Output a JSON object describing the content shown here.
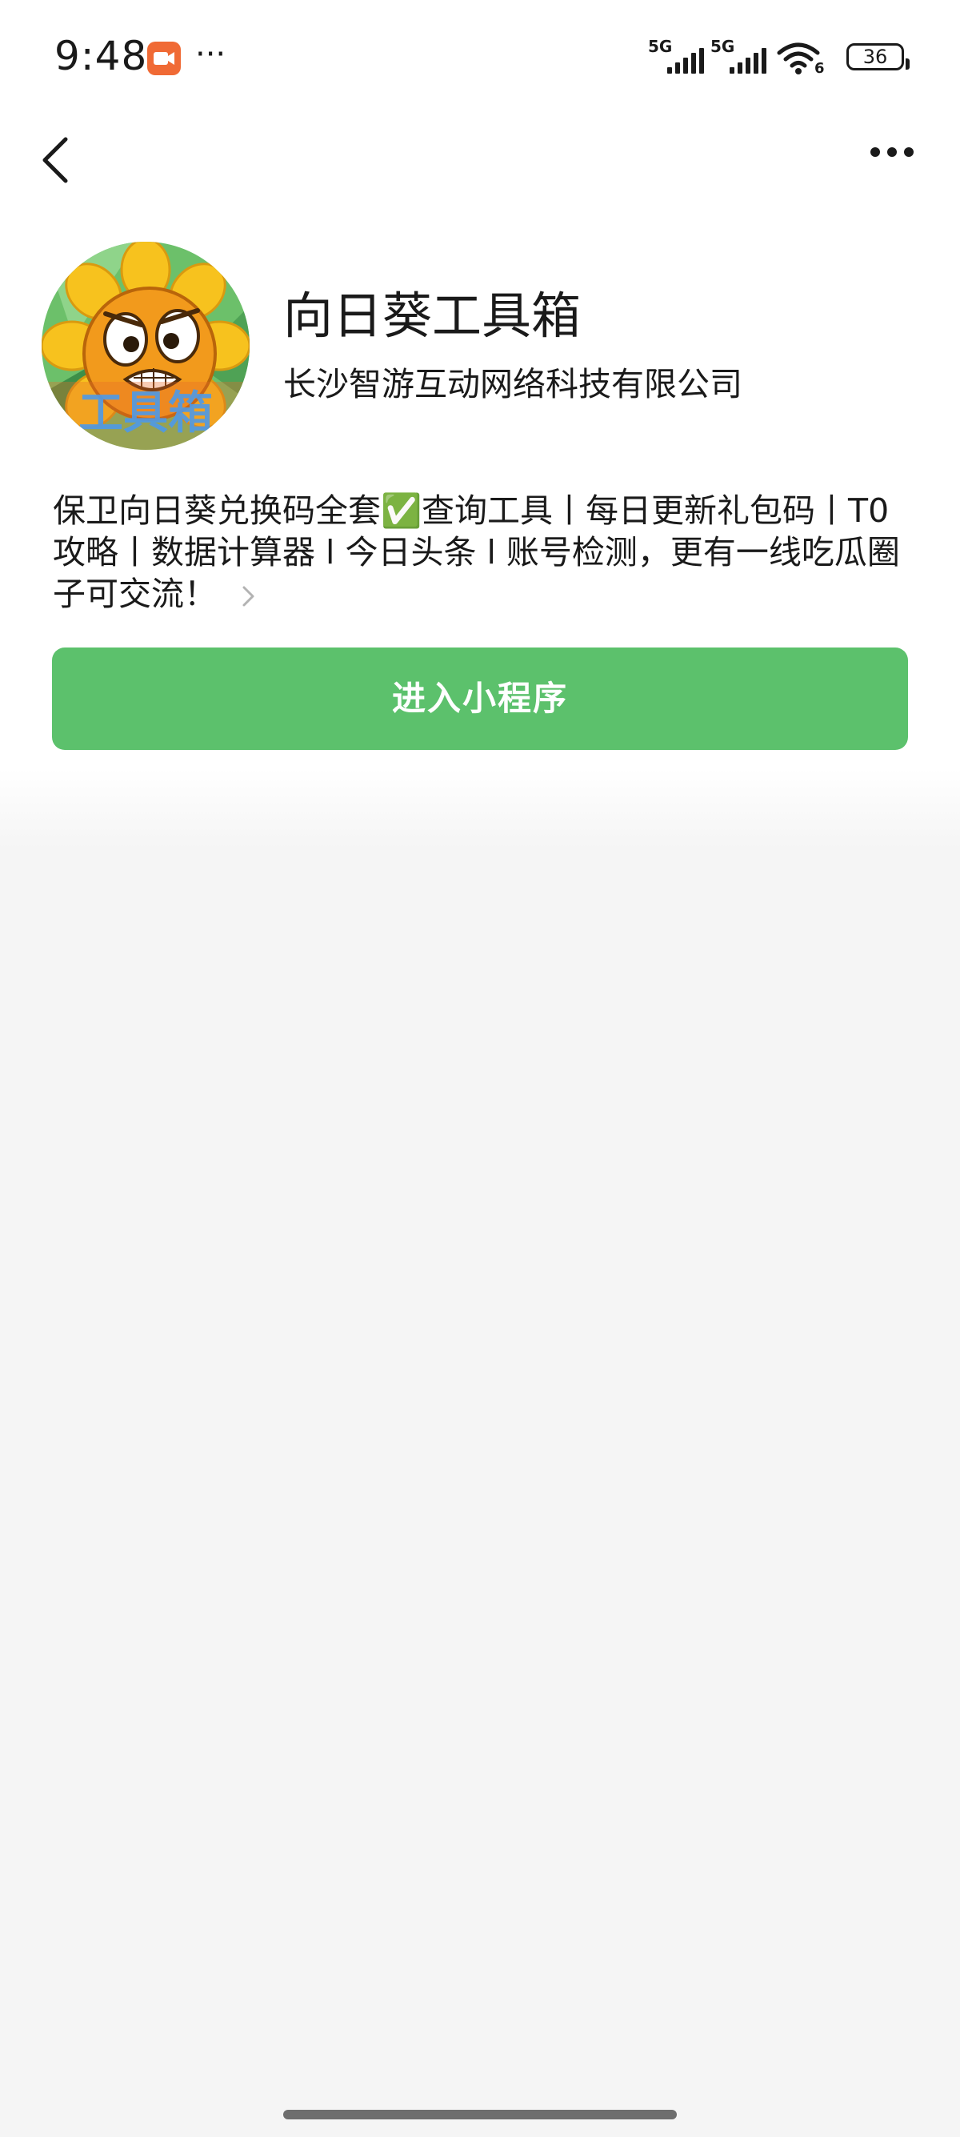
{
  "status_bar": {
    "time": "9:48",
    "signal_1_label": "5G",
    "signal_2_label": "5G",
    "wifi_badge": "6",
    "battery_level": "36",
    "app_icon": "video-app-icon",
    "overflow": "···"
  },
  "nav": {
    "back_icon": "chevron-left-icon",
    "more_icon": "more-horizontal-icon"
  },
  "profile": {
    "avatar_caption": "工具箱",
    "name": "向日葵工具箱",
    "company": "长沙智游互动网络科技有限公司",
    "description": "保卫向日葵兑换码全套✅查询工具丨每日更新礼包码丨T0攻略丨数据计算器 l 今日头条 l 账号检测，更有一线吃瓜圈子可交流！"
  },
  "actions": {
    "enter_label": "进入小程序"
  },
  "colors": {
    "accent": "#5cc16c",
    "background": "#f5f5f5",
    "app_icon_orange": "#f06a35"
  }
}
